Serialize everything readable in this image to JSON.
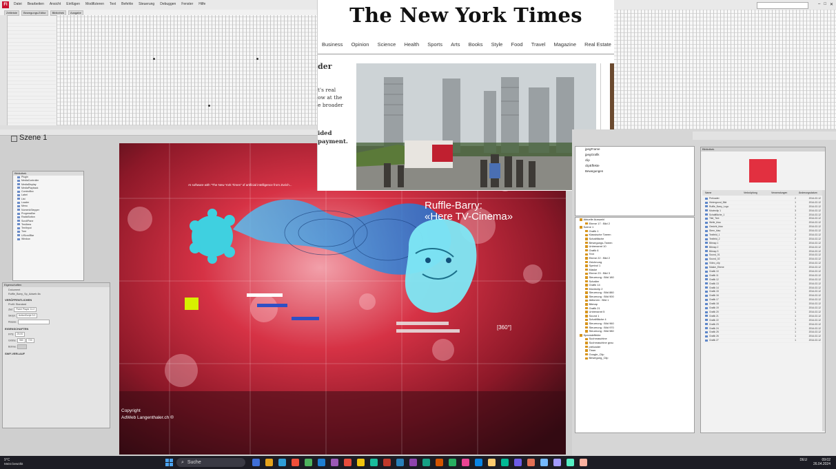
{
  "app": {
    "menu": [
      "Datei",
      "Bearbeiten",
      "Ansicht",
      "Einfügen",
      "Modifizieren",
      "Text",
      "Befehle",
      "Steuerung",
      "Debuggen",
      "Fenster",
      "Hilfe"
    ],
    "tabs": [
      "Zeitleiste",
      "Bewegungs-Editor",
      "Bibliothek",
      "Ausgabe"
    ],
    "scene_label": "Szene 1"
  },
  "nyt": {
    "masthead": "The New York Times",
    "nav": [
      "Business",
      "Opinion",
      "Science",
      "Health",
      "Sports",
      "Arts",
      "Books",
      "Style",
      "Food",
      "Travel",
      "Magazine",
      "Real Estate"
    ],
    "left_heading": "der",
    "left_body": [
      "t's real",
      "ow at the",
      "e broader"
    ],
    "left_bold": [
      "ided",
      "payment."
    ]
  },
  "stage": {
    "headline": "Ruffle-Barry:",
    "subhead": "«Here TV-Cinema»",
    "tag_360": "[360°]",
    "copyright_1": "Copyright",
    "copyright_2": "AdWeb Langenthaler.ch ®"
  },
  "library_panel": {
    "title": "Bibliothek",
    "items": [
      "Plugin",
      "MediaController",
      "MediaDisplay",
      "MediaPlayback",
      "ComboBox",
      "Label",
      "List",
      "Loader",
      "Menu",
      "NumericStepper",
      "ProgressBar",
      "RadioButton",
      "ScrollPane",
      "TextArea",
      "TextInput",
      "Tree",
      "UIScrollBar",
      "Window"
    ]
  },
  "properties": {
    "title": "Eigenschaften",
    "doc_label": "Dokument",
    "doc_name": "Ruffle_Barry_Sp_Adweb.fla",
    "sections": [
      "VERÖFFENTLICHEN",
      "EIGENSCHAFTEN",
      "SWF-VERLAUF"
    ],
    "profile_label": "Profil: Standard",
    "player_label": "Ziel:",
    "player_value": "Flash Player 11.2",
    "script_label": "Skript:",
    "script_value": "ActionScript 3.0",
    "class_label": "Klasse:",
    "fps_label": "FPS:",
    "fps_value": "25.00",
    "size_label": "Größe:",
    "size_w": "960",
    "size_h": "720",
    "stage_label": "Bühne:"
  },
  "outline_top": [
    "jpegFrame",
    "jpegGrafik",
    "clip",
    "clipEffekte",
    "Bewegungen"
  ],
  "outline_tree": [
    "Aktuelle Auswahl",
    "Ebene 17 : Bild 2",
    "Szene 1",
    "Grafik 1",
    "Klassische Tween",
    "Schaltfläche",
    "Bewegungs-Tween",
    "Unbenannt 10",
    "Grafik 6",
    "Text",
    "Ebene 22 : Bild 2",
    "Zeichnung",
    "Symbol 1",
    "Maske",
    "Ebene 23 : Bild 3",
    "Steuerung : Bild 180",
    "Schalter",
    "Grafik 14",
    "Movieclip 2",
    "Steuerung : Bild 880",
    "Steuerung : Bild 900",
    "Aktionen : Bild 1",
    "Bitmap",
    "Grafik 21",
    "Unbenannt 5",
    "Sound 1",
    "Schaltfläche 4",
    "Steuerung : Bild 960",
    "Steuerung : Bild 970",
    "Steuerung : Bild 980",
    "Spezialeffekte",
    "Suchmaschine",
    "Suchmaschine grau",
    "preloader",
    "Timer",
    "Google_Clip",
    "Bewegung_Clip"
  ],
  "library2": {
    "title": "Bibliothek",
    "header": [
      "Name",
      "Verknüpfung",
      "Verwendungen",
      "Änderungsdatum"
    ],
    "items": [
      [
        "Preloader",
        "",
        "2",
        "2014-02-12"
      ],
      [
        "Hintergrund_Bild",
        "",
        "1",
        "2014-02-12"
      ],
      [
        "Ruffle_Barry_Logo",
        "",
        "1",
        "2014-02-12"
      ],
      [
        "Movieclip 1",
        "",
        "3",
        "2014-02-12"
      ],
      [
        "Schaltfläche_1",
        "",
        "1",
        "2014-02-12"
      ],
      [
        "Titel_Text",
        "",
        "1",
        "2014-02-12"
      ],
      [
        "Welle_blau",
        "",
        "1",
        "2014-02-12"
      ],
      [
        "Gesicht_blau",
        "",
        "1",
        "2014-02-12"
      ],
      [
        "Stern_blau",
        "",
        "1",
        "2014-02-12"
      ],
      [
        "Textfeld_1",
        "",
        "2",
        "2014-02-12"
      ],
      [
        "Textfeld_2",
        "",
        "2",
        "2014-02-12"
      ],
      [
        "Bitmap 1",
        "",
        "1",
        "2014-02-12"
      ],
      [
        "Bitmap 2",
        "",
        "1",
        "2014-02-12"
      ],
      [
        "Bitmap 3",
        "",
        "1",
        "2014-02-12"
      ],
      [
        "Sound_01",
        "",
        "1",
        "2014-02-12"
      ],
      [
        "Sound_02",
        "",
        "1",
        "2014-02-12"
      ],
      [
        "Video_clip",
        "",
        "1",
        "2014-02-12"
      ],
      [
        "Maske_Ebene",
        "",
        "4",
        "2014-02-12"
      ],
      [
        "Grafik 10",
        "",
        "1",
        "2014-02-12"
      ],
      [
        "Grafik 11",
        "",
        "1",
        "2014-02-12"
      ],
      [
        "Grafik 12",
        "",
        "1",
        "2014-02-12"
      ],
      [
        "Grafik 13",
        "",
        "1",
        "2014-02-12"
      ],
      [
        "Grafik 14",
        "",
        "1",
        "2014-02-12"
      ],
      [
        "Grafik 15",
        "",
        "1",
        "2014-02-12"
      ],
      [
        "Grafik 16",
        "",
        "1",
        "2014-02-12"
      ],
      [
        "Grafik 17",
        "",
        "1",
        "2014-02-12"
      ],
      [
        "Grafik 18",
        "",
        "1",
        "2014-02-12"
      ],
      [
        "Grafik 19",
        "",
        "1",
        "2014-02-12"
      ],
      [
        "Grafik 20",
        "",
        "1",
        "2014-02-12"
      ],
      [
        "Grafik 21",
        "",
        "1",
        "2014-02-12"
      ],
      [
        "Grafik 22",
        "",
        "1",
        "2014-02-12"
      ],
      [
        "Grafik 23",
        "",
        "1",
        "2014-02-12"
      ],
      [
        "Grafik 24",
        "",
        "1",
        "2014-02-12"
      ],
      [
        "Grafik 25",
        "",
        "1",
        "2014-02-12"
      ],
      [
        "Grafik 26",
        "",
        "1",
        "2014-02-12"
      ],
      [
        "Grafik 27",
        "",
        "1",
        "2014-02-12"
      ]
    ]
  },
  "taskbar": {
    "temp": "9°C",
    "weather": "Meist bewölkt",
    "search": "Suche",
    "lang": "DEU",
    "time": "09:02",
    "date": "26.04.2024",
    "app_colors": [
      "#3f6fd8",
      "#e5a31b",
      "#2f9ed8",
      "#f04f3a",
      "#4db35e",
      "#1e7ed1",
      "#9b59b6",
      "#e74c3c",
      "#f1c40f",
      "#1abc9c",
      "#c0392b",
      "#2980b9",
      "#8e44ad",
      "#16a085",
      "#d35400",
      "#27ae60",
      "#e84393",
      "#0984e3",
      "#fdcb6e",
      "#00b894",
      "#6c5ce7",
      "#e17055",
      "#74b9ff",
      "#a29bfe",
      "#55efc4",
      "#fab1a0"
    ]
  },
  "colors": {
    "nyt_bg": "#ffffff",
    "stage_red": "#d6283c",
    "wave_blue": "#3aa7e8",
    "face_cyan": "#5fe0f0",
    "taskbar": "#1c1c24"
  }
}
